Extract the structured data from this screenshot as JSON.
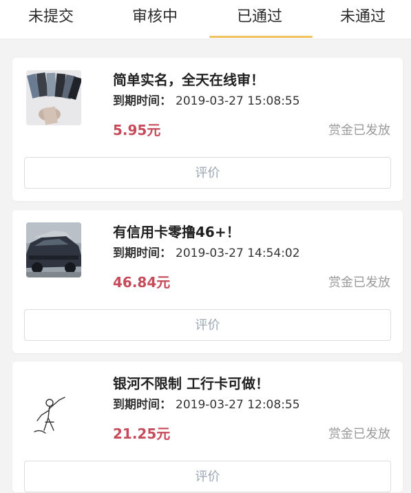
{
  "tabs": [
    {
      "label": "未提交"
    },
    {
      "label": "审核中"
    },
    {
      "label": "已通过"
    },
    {
      "label": "未通过"
    }
  ],
  "active_tab": "已通过",
  "colors": {
    "accent": "#f2c35c",
    "reward": "#c64a5a",
    "status": "#9a9a9a",
    "button_text": "#9aa6b5"
  },
  "tasks": [
    {
      "title": "简单实名，全天在线审！",
      "deadline_label": "到期时间：",
      "deadline": "2019-03-27 15:08:55",
      "reward": "5.95元",
      "status": "赏金已发放",
      "button": "评价",
      "thumbnail_icon": "photo-cards-icon"
    },
    {
      "title": "有信用卡零撸46+！",
      "deadline_label": "到期时间：",
      "deadline": "2019-03-27 14:54:02",
      "reward": "46.84元",
      "status": "赏金已发放",
      "button": "评价",
      "thumbnail_icon": "car-photo-icon"
    },
    {
      "title": "银河不限制 工行卡可做！",
      "deadline_label": "到期时间：",
      "deadline": "2019-03-27 12:08:55",
      "reward": "21.25元",
      "status": "赏金已发放",
      "button": "评价",
      "thumbnail_icon": "figure-sketch-icon"
    }
  ]
}
